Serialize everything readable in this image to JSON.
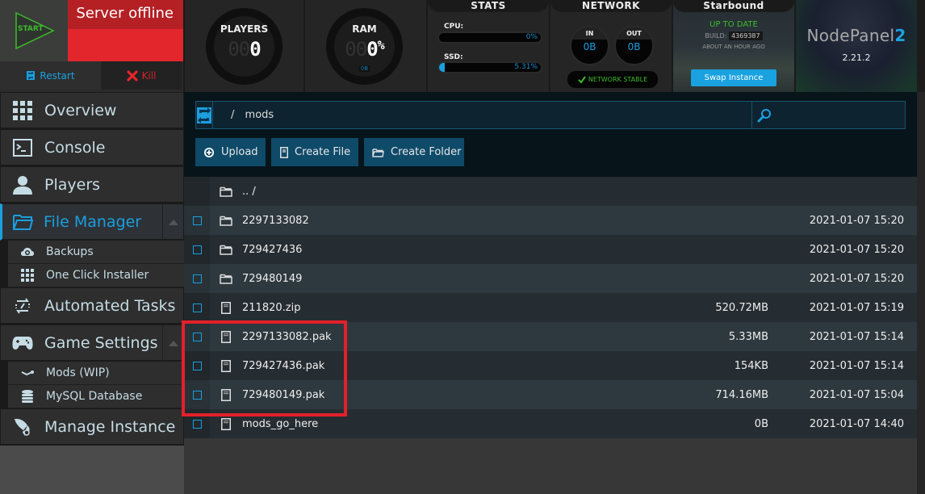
{
  "server": {
    "start_label": "START",
    "status_text": "Server offline",
    "restart_label": "Restart",
    "kill_label": "Kill"
  },
  "gauges": {
    "players": {
      "title": "PLAYERS",
      "ghost_digits": "00",
      "value": "0"
    },
    "ram": {
      "title": "RAM",
      "ghost_digits": "00",
      "value": "0",
      "unit": "%",
      "sub": "0B"
    }
  },
  "stats": {
    "title": "STATS",
    "cpu": {
      "label": "CPU:",
      "value_text": "0%",
      "percent": 0
    },
    "ssd": {
      "label": "SSD:",
      "value_text": "5.31%",
      "percent": 5.31
    }
  },
  "network": {
    "title": "NETWORK",
    "in": {
      "label": "IN",
      "value": "0B"
    },
    "out": {
      "label": "OUT",
      "value": "0B"
    },
    "status": "NETWORK STABLE"
  },
  "game": {
    "title": "Starbound",
    "update_status": "UP TO DATE",
    "build_label": "BUILD:",
    "build_number": "4369387",
    "updated_ago": "ABOUT AN HOUR AGO",
    "swap_label": "Swap Instance"
  },
  "brand": {
    "name": "NodePanel",
    "name_suffix": "2",
    "version": "2.21.2"
  },
  "sidebar": {
    "items": [
      {
        "label": "Overview",
        "icon": "grid-icon"
      },
      {
        "label": "Console",
        "icon": "terminal-icon"
      },
      {
        "label": "Players",
        "icon": "user-icon"
      },
      {
        "label": "File Manager",
        "icon": "folder-open-icon",
        "active": true,
        "children": [
          {
            "label": "Backups",
            "icon": "cloud-backup-icon"
          },
          {
            "label": "One Click Installer",
            "icon": "grid-icon"
          }
        ]
      },
      {
        "label": "Automated Tasks",
        "icon": "automation-icon"
      },
      {
        "label": "Game Settings",
        "icon": "gamepad-icon",
        "children": [
          {
            "label": "Mods (WIP)",
            "icon": "steam-icon"
          },
          {
            "label": "MySQL Database",
            "icon": "database-icon"
          }
        ]
      },
      {
        "label": "Manage Instance",
        "icon": "rocket-icon"
      }
    ]
  },
  "file_manager": {
    "path_separator": "/",
    "current_path": "mods",
    "search_placeholder": "",
    "search_value": "",
    "actions": {
      "upload": "Upload",
      "create_file": "Create File",
      "create_folder": "Create Folder"
    },
    "parent_label": ".. /",
    "files": [
      {
        "name": "2297133082",
        "type": "folder",
        "size": "",
        "modified": "2021-01-07 15:20"
      },
      {
        "name": "729427436",
        "type": "folder",
        "size": "",
        "modified": "2021-01-07 15:20"
      },
      {
        "name": "729480149",
        "type": "folder",
        "size": "",
        "modified": "2021-01-07 15:20"
      },
      {
        "name": "211820.zip",
        "type": "file",
        "size": "520.72MB",
        "modified": "2021-01-07 15:19"
      },
      {
        "name": "2297133082.pak",
        "type": "file",
        "size": "5.33MB",
        "modified": "2021-01-07 15:14"
      },
      {
        "name": "729427436.pak",
        "type": "file",
        "size": "154KB",
        "modified": "2021-01-07 15:14"
      },
      {
        "name": "729480149.pak",
        "type": "file",
        "size": "714.16MB",
        "modified": "2021-01-07 15:04"
      },
      {
        "name": "mods_go_here",
        "type": "file",
        "size": "0B",
        "modified": "2021-01-07 14:40"
      }
    ]
  },
  "colors": {
    "accent": "#1a9fdf",
    "offline_red": "#e3262b",
    "ok_green": "#3dbb2c",
    "annotation_red": "#e3202a"
  }
}
